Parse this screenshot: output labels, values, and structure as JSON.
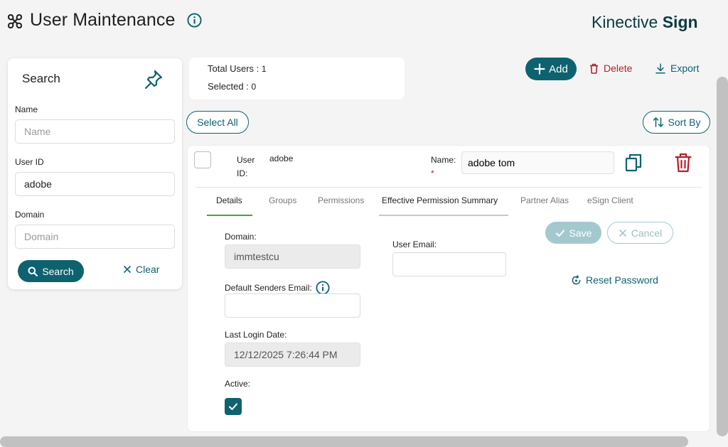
{
  "header": {
    "title": "User Maintenance",
    "brand_light": "Kinective ",
    "brand_bold": "Sign"
  },
  "search_panel": {
    "title": "Search",
    "name_label": "Name",
    "name_placeholder": "Name",
    "name_value": "",
    "userid_label": "User ID",
    "userid_value": "adobe",
    "domain_label": "Domain",
    "domain_placeholder": "Domain",
    "domain_value": "",
    "search_button": "Search",
    "clear_button": "Clear"
  },
  "stats": {
    "total_label": "Total Users : ",
    "total_value": "1",
    "selected_label": "Selected : ",
    "selected_value": "0"
  },
  "toolbar": {
    "add": "Add",
    "delete": "Delete",
    "export": "Export",
    "select_all": "Select All",
    "sort_by": "Sort By"
  },
  "user": {
    "userid_label_1": "User",
    "userid_label_2": "ID:",
    "userid_value": "adobe",
    "name_label": "Name:",
    "required_mark": "*",
    "name_value": "adobe tom"
  },
  "tabs": [
    {
      "label": "Details",
      "active": true
    },
    {
      "label": "Groups",
      "active": false
    },
    {
      "label": "Permissions",
      "active": false
    },
    {
      "label": "Effective Permission Summary",
      "active": false
    },
    {
      "label": "Partner Alias",
      "active": false
    },
    {
      "label": "eSign Client",
      "active": false
    }
  ],
  "details": {
    "domain_label": "Domain:",
    "domain_value": "immtestcu",
    "default_senders_email_label": "Default Senders Email:",
    "default_senders_email_value": "",
    "last_login_label": "Last Login Date:",
    "last_login_value": "12/12/2025 7:26:44 PM",
    "active_label": "Active:",
    "active_checked": true,
    "user_email_label": "User Email:",
    "user_email_value": "",
    "save_button": "Save",
    "cancel_button": "Cancel",
    "reset_password": "Reset Password"
  },
  "colors": {
    "primary": "#0e6270",
    "danger": "#b0212b",
    "tab_active_underline": "#4aa03f"
  }
}
